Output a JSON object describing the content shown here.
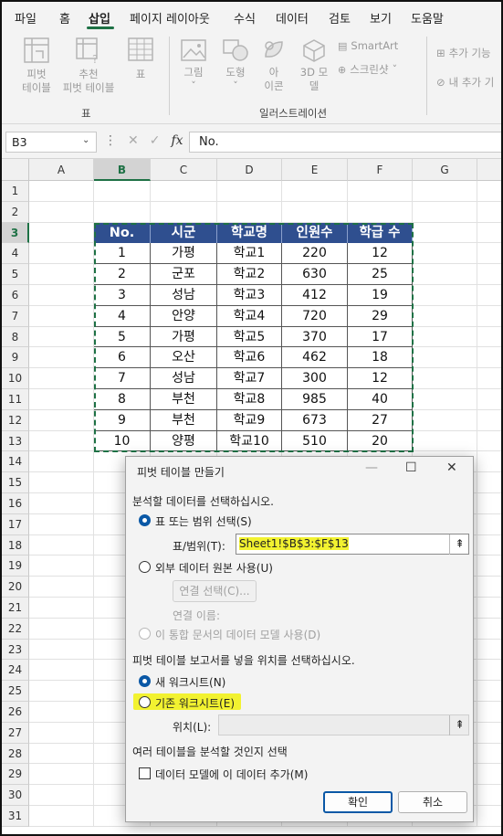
{
  "menu": {
    "items": [
      "파일",
      "홈",
      "삽입",
      "페이지 레이아웃",
      "수식",
      "데이터",
      "검토",
      "보기",
      "도움말"
    ],
    "active": "삽입"
  },
  "ribbon": {
    "pivot_line1": "피벗",
    "pivot_line2": "테이블",
    "recpivot_line1": "추천",
    "recpivot_line2": "피벗 테이블",
    "table": "표",
    "picture": "그림",
    "shape": "도형",
    "icon_line1": "아",
    "icon_line2": "이콘",
    "model3d_line1": "3D 모",
    "model3d_line2": "델",
    "smartart": "SmartArt",
    "screenshot": "스크린샷",
    "addins": "추가 기능",
    "myaddins": "내 추가 기",
    "group_tables": "표",
    "group_illustrations": "일러스트레이션",
    "dropdown_glyph": "ˇ"
  },
  "formula_bar": {
    "name_box": "B3",
    "formula": "No."
  },
  "grid": {
    "columns": [
      "A",
      "B",
      "C",
      "D",
      "E",
      "F",
      "G"
    ],
    "selected_column": "B",
    "rows": [
      "1",
      "2",
      "3",
      "4",
      "5",
      "6",
      "7",
      "8",
      "9",
      "10",
      "11",
      "12",
      "13",
      "14",
      "15",
      "16",
      "17",
      "18",
      "19",
      "20",
      "21",
      "22",
      "23",
      "24",
      "25",
      "26",
      "27",
      "28",
      "29",
      "30",
      "31"
    ],
    "selected_row": "3"
  },
  "table": {
    "headers": [
      "No.",
      "시군",
      "학교명",
      "인원수",
      "학급 수"
    ],
    "rows": [
      [
        "1",
        "가평",
        "학교1",
        "220",
        "12"
      ],
      [
        "2",
        "군포",
        "학교2",
        "630",
        "25"
      ],
      [
        "3",
        "성남",
        "학교3",
        "412",
        "19"
      ],
      [
        "4",
        "안양",
        "학교4",
        "720",
        "29"
      ],
      [
        "5",
        "가평",
        "학교5",
        "370",
        "17"
      ],
      [
        "6",
        "오산",
        "학교6",
        "462",
        "18"
      ],
      [
        "7",
        "성남",
        "학교7",
        "300",
        "12"
      ],
      [
        "8",
        "부천",
        "학교8",
        "985",
        "40"
      ],
      [
        "9",
        "부천",
        "학교9",
        "673",
        "27"
      ],
      [
        "10",
        "양평",
        "학교10",
        "510",
        "20"
      ]
    ]
  },
  "dialog": {
    "title": "피벗 테이블 만들기",
    "section1": "분석할 데이터를 선택하십시오.",
    "opt_table": "표 또는 범위 선택(S)",
    "range_label": "표/범위(T):",
    "range_value": "Sheet1!$B$3:$F$13",
    "opt_external": "외부 데이터 원본 사용(U)",
    "choose_conn": "연결 선택(C)...",
    "conn_name": "연결 이름:",
    "opt_datamodel": "이 통합 문서의 데이터 모델 사용(D)",
    "section2": "피벗 테이블 보고서를 넣을 위치를 선택하십시오.",
    "opt_new": "새 워크시트(N)",
    "opt_existing": "기존 워크시트(E)",
    "location_label": "위치(L):",
    "location_value": "",
    "section3": "여러 테이블을 분석할 것인지 선택",
    "chk_datamodel": "데이터 모델에 이 데이터 추가(M)",
    "ok": "확인",
    "cancel": "취소"
  },
  "colors": {
    "header_fill": "#2f4f8f",
    "excel_green": "#1e7145",
    "accent_blue": "#0a58a6",
    "highlight": "#f2f230"
  }
}
